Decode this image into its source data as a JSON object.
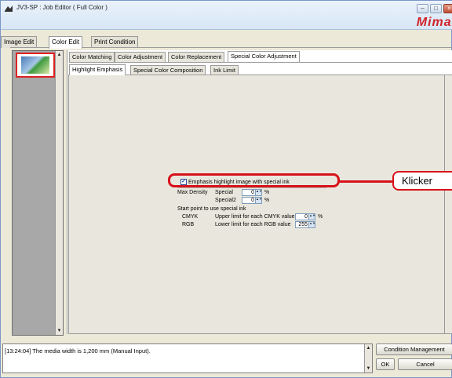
{
  "window": {
    "title": "JV3-SP : Job Editor ( Full Color )",
    "brand": "Mimaki"
  },
  "main_tabs": [
    "Image Edit",
    "Color Edit",
    "Print Condition"
  ],
  "sub_tabs": [
    "Color Matching",
    "Color Adjustment",
    "Color Replacement",
    "Special Color Adjustment"
  ],
  "inner_tabs": [
    "Highlight Emphasis",
    "Special Color Composition",
    "Ink Limit"
  ],
  "highlight": {
    "checkbox_label": "Emphasis highlight image with special ink",
    "checked": true,
    "max_density_label": "Max Density",
    "special_label": "Special",
    "special_value": "0",
    "special2_label": "Special2",
    "special2_value": "0",
    "percent": "%",
    "start_point_label": "Start point to use special ink",
    "cmyk_label": "CMYK",
    "cmyk_desc": "Upper limit for each CMYK value",
    "cmyk_value": "0",
    "rgb_label": "RGB",
    "rgb_desc": "Lower limit for each RGB value",
    "rgb_value": "255"
  },
  "callout_text": "Klicker",
  "log_text": "[13:24:04] The media width is 1,200 mm (Manual Input).",
  "buttons": {
    "condition_management": "Condition Management",
    "ok": "OK",
    "cancel": "Cancel"
  }
}
